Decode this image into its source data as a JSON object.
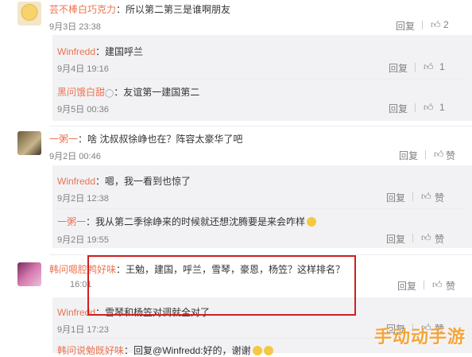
{
  "comments": [
    {
      "user": "芸不棒白巧克力",
      "text": "：所以第二第三是谁啊朋友",
      "time": "9月3日 23:38",
      "reply": "回复",
      "replies": [
        {
          "user": "Winfredd",
          "text": "：建国呼兰",
          "time": "9月4日 19:16",
          "reply": "回复"
        },
        {
          "user": "黑问饿白甜",
          "text": "：友谊第一建国第二",
          "time": "9月5日 00:36",
          "reply": "回复"
        }
      ]
    },
    {
      "user": "一粥一",
      "text": "：啥 沈叔叔徐峥也在？阵容太豪华了吧",
      "time": "9月2日 00:46",
      "reply": "回复",
      "like": "赞",
      "replies": [
        {
          "user": "Winfredd",
          "text": "：嗯，我一看到也惊了",
          "time": "9月2日 12:38",
          "reply": "回复",
          "like": "赞"
        },
        {
          "user": "一粥一",
          "text": "：我从第二季徐峥来的时候就还想沈腾要是来会咋样",
          "time": "9月2日 19:55",
          "reply": "回复",
          "like": "赞"
        }
      ]
    },
    {
      "user": "韩问嗯腔鸭好味",
      "text": "：王勉，建国，呼兰，雪琴，豪恩，杨笠？这样排名？",
      "time": "16:01",
      "reply": "回复",
      "like": "赞",
      "replies": [
        {
          "user": "Winfredd",
          "text": "：雪琴和杨笠对调就全对了",
          "time": "9月1日 17:23",
          "reply": "回复",
          "like": "赞"
        },
        {
          "user": "韩问说勉既好味",
          "text": "：回复@Winfredd:好的，谢谢",
          "time": "",
          "reply": "",
          "like": ""
        }
      ]
    }
  ],
  "watermark": "手动动手游"
}
